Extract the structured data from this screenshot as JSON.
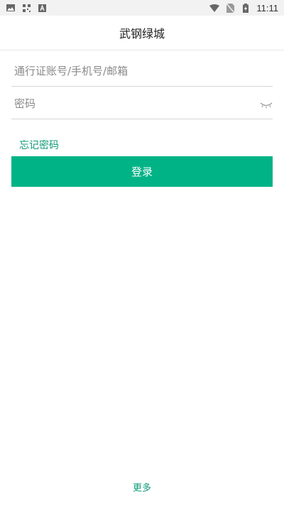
{
  "status_bar": {
    "time": "11:11",
    "left_icons": [
      "image-icon",
      "qr-icon",
      "a-icon"
    ],
    "right_icons": [
      "wifi-icon",
      "no-sim-icon",
      "battery-charging-icon"
    ]
  },
  "header": {
    "title": "武钢绿城"
  },
  "form": {
    "account_placeholder": "通行证账号/手机号/邮箱",
    "password_placeholder": "密码",
    "forgot_label": "忘记密码",
    "login_label": "登录"
  },
  "footer": {
    "more_label": "更多"
  },
  "colors": {
    "accent": "#00b386",
    "link": "#0f9a78"
  }
}
